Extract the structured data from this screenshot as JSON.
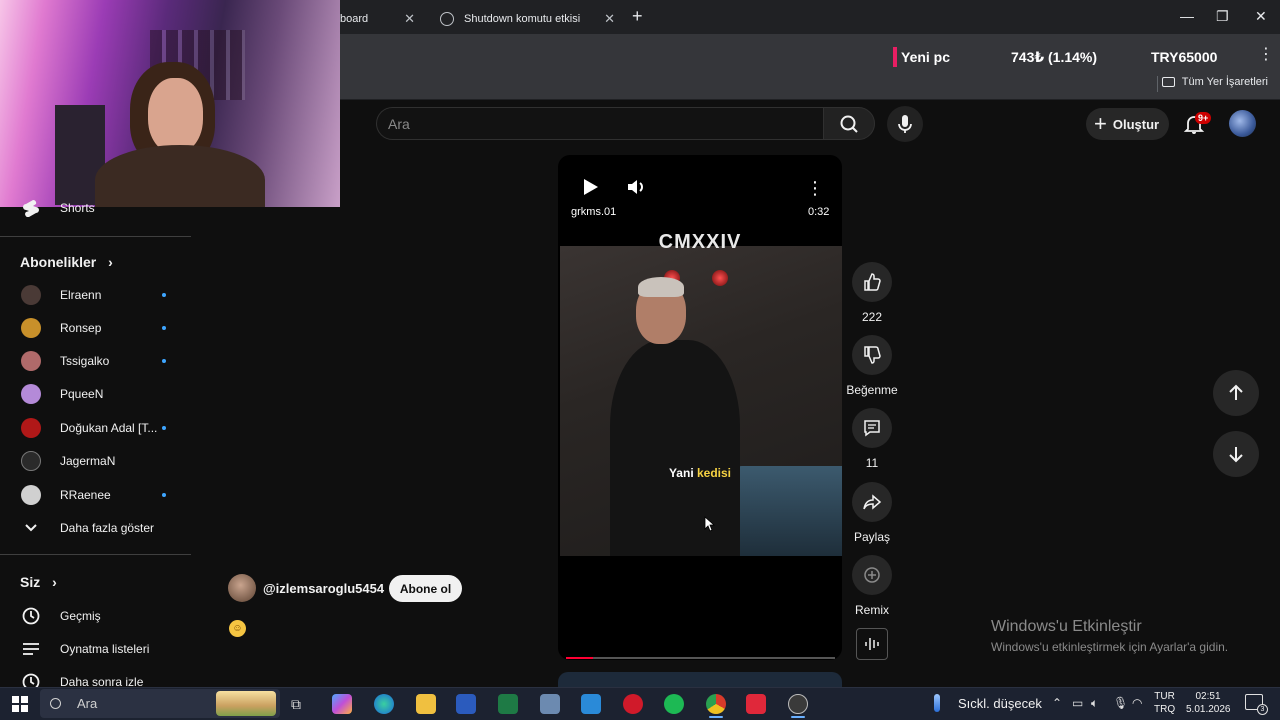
{
  "browser": {
    "tabs": [
      {
        "label": "board"
      },
      {
        "label": "Shutdown komutu etkisi"
      }
    ],
    "new_tab": "+",
    "ticker": {
      "name": "Yeni pc",
      "price": "743₺ (1.14%)",
      "target": "TRY65000"
    },
    "bookmarks_all": "Tüm Yer İşaretleri"
  },
  "header": {
    "search_placeholder": "Ara",
    "create_label": "Oluştur",
    "notifications_badge": "9+"
  },
  "sidebar": {
    "shorts_label": "Shorts",
    "subscriptions_title": "Abonelikler",
    "subscriptions": [
      {
        "name": "Elraenn",
        "avatar_color": "#4a3a36",
        "new": true
      },
      {
        "name": "Ronsep",
        "avatar_color": "#c8902a",
        "new": true
      },
      {
        "name": "Tssigalko",
        "avatar_color": "#b06a6a",
        "new": true
      },
      {
        "name": "PqueeN",
        "avatar_color": "#b48ad8",
        "new": false
      },
      {
        "name": "Doğukan Adal [T...",
        "avatar_color": "#b01818",
        "new": true
      },
      {
        "name": "JagermaN",
        "avatar_color": "#2a2a2a",
        "new": false
      },
      {
        "name": "RRaenee",
        "avatar_color": "#d0d0d0",
        "new": true
      }
    ],
    "show_more": "Daha fazla göster",
    "you_title": "Siz",
    "you_items": [
      "Geçmiş",
      "Oynatma listeleri",
      "Daha sonra izle"
    ]
  },
  "short": {
    "channel": "grkms.01",
    "duration": "0:32",
    "title_overlay": "CMXXIV",
    "subtitle_prefix": "Yani ",
    "subtitle_highlight": "kedisi",
    "progress": 0.1,
    "accent_color": "#ff0033"
  },
  "actions": {
    "likes": "222",
    "dislike_label": "Beğenme",
    "comments": "11",
    "share_label": "Paylaş",
    "remix_label": "Remix"
  },
  "uploader": {
    "handle": "@izlemsaroglu5454",
    "subscribe_label": "Abone ol"
  },
  "watermark": {
    "line1": "Windows'u Etkinleştir",
    "line2": "Windows'u etkinleştirmek için Ayarlar'a gidin."
  },
  "taskbar": {
    "search_label": "Ara",
    "weather": "Sıckl. düşecek",
    "lang_top": "TUR",
    "lang_bottom": "TRQ",
    "time": "02:51",
    "date": "5.01.2026",
    "notification_count": "3"
  }
}
